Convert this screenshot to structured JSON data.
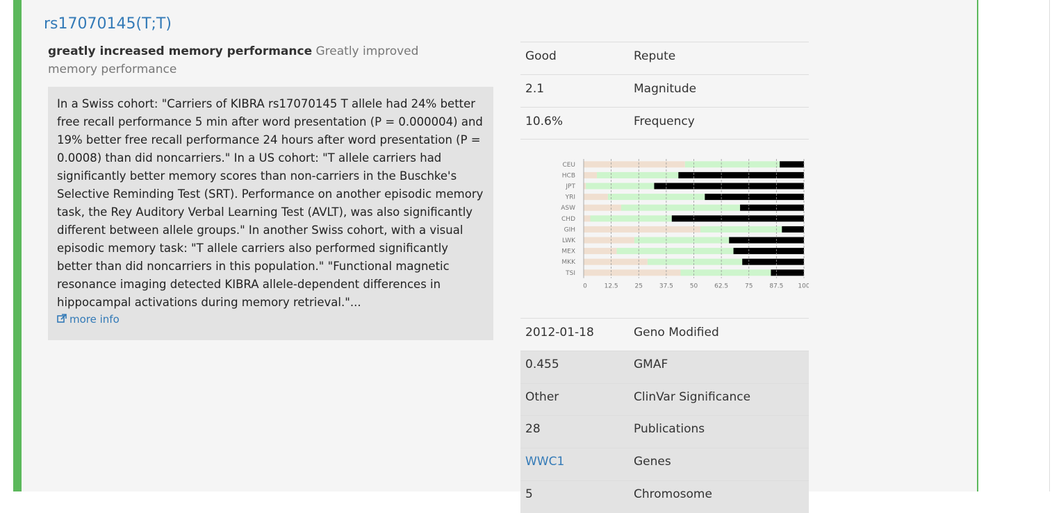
{
  "genotype": {
    "title": "rs17070145(T;T)",
    "summary_bold": "greatly increased memory performance",
    "summary_rest": "Greatly improved memory performance",
    "description": "In a Swiss cohort: \"Carriers of KIBRA rs17070145 T allele had 24% better free recall performance 5 min after word presentation (P = 0.000004) and 19% better free recall performance 24 hours after word presentation (P = 0.0008) than did noncarriers.\" In a US cohort: \"T allele carriers had significantly better memory scores than non-carriers in the Buschke's Selective Reminding Test (SRT). Performance on another episodic memory task, the Rey Auditory Verbal Learning Test (AVLT), was also significantly different between allele groups.\" In another Swiss cohort, with a visual episodic memory task: \"T allele carriers also performed significantly better than did noncarriers in this population.\" \"Functional magnetic resonance imaging detected KIBRA allele-dependent differences in hippocampal activations during memory retrieval.\"...",
    "more_info_label": "more info",
    "more_info_icon": "external-link-icon"
  },
  "info_top": [
    {
      "value": "Good",
      "label": "Repute"
    },
    {
      "value": "2.1",
      "label": "Magnitude"
    },
    {
      "value": "10.6%",
      "label": "Frequency"
    }
  ],
  "info_bottom": [
    {
      "value": "2012-01-18",
      "label": "Geno Modified"
    },
    {
      "value": "0.455",
      "label": "GMAF"
    },
    {
      "value": "Other",
      "label": "ClinVar Significance"
    },
    {
      "value": "28",
      "label": "Publications"
    },
    {
      "value": "WWC1",
      "label": "Genes"
    },
    {
      "value": "5",
      "label": "Chromosome"
    }
  ],
  "chart_data": {
    "type": "bar",
    "stacked": true,
    "orientation": "horizontal",
    "categories": [
      "CEU",
      "HCB",
      "JPT",
      "YRI",
      "ASW",
      "CHD",
      "GIH",
      "LWK",
      "MEX",
      "MKK",
      "TSI"
    ],
    "series": [
      {
        "values": [
          46,
          6,
          1,
          11,
          17,
          3,
          53,
          23,
          15,
          29,
          44
        ],
        "color": "#f0dfd0"
      },
      {
        "values": [
          43,
          37,
          31,
          44,
          54,
          37,
          37,
          43,
          53,
          43,
          41
        ],
        "color": "#cdf5cc"
      },
      {
        "values": [
          11,
          57,
          68,
          45,
          29,
          60,
          10,
          34,
          32,
          28,
          15
        ],
        "color": "#000000"
      }
    ],
    "xticks": [
      "0",
      "12.5",
      "25",
      "37.5",
      "50",
      "62.5",
      "75",
      "87.5",
      "100"
    ],
    "xlim": [
      0,
      100
    ],
    "grid": true
  }
}
